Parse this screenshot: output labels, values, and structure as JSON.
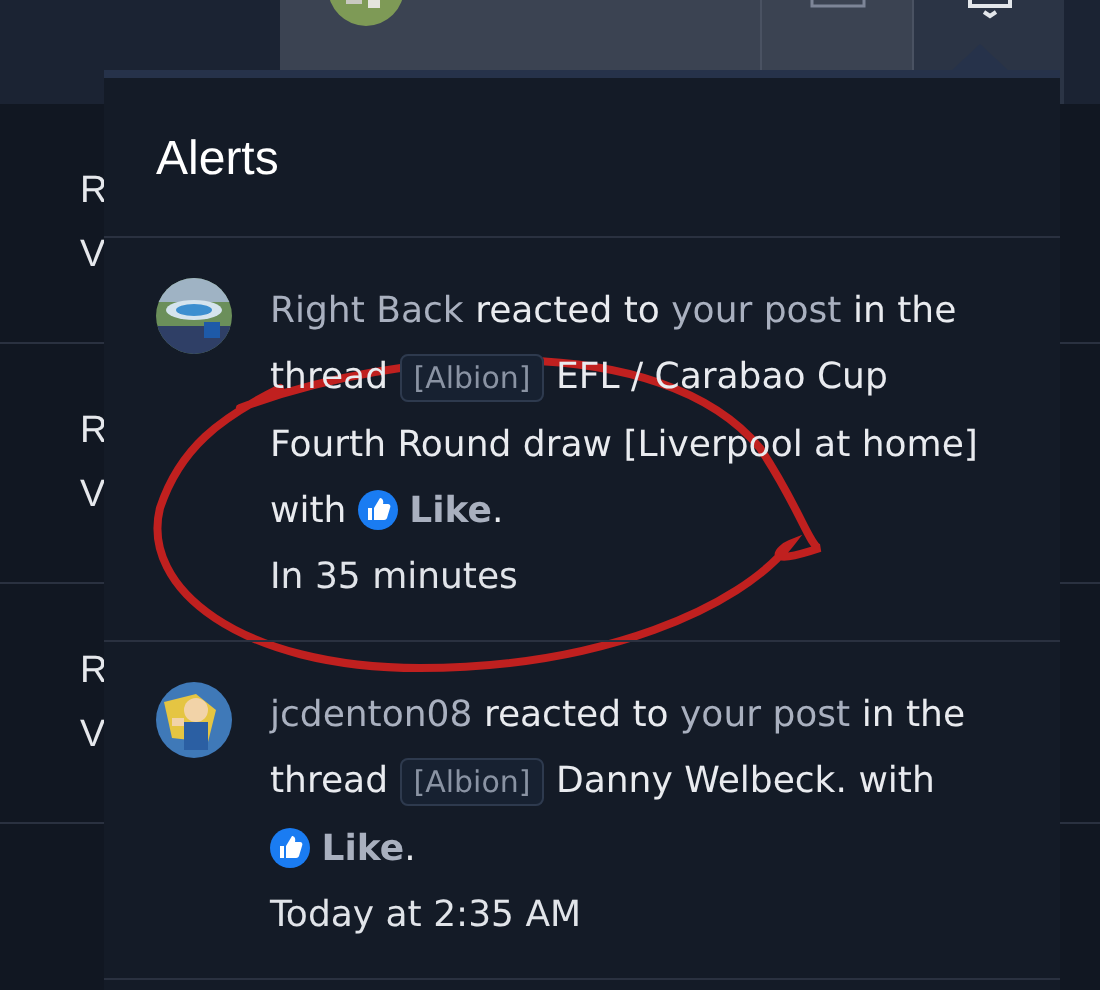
{
  "background_rows": [
    {
      "line_1": "R",
      "line_2": "V"
    },
    {
      "line_1": "R",
      "line_2": "V"
    },
    {
      "line_1": "R",
      "line_2": "V"
    }
  ],
  "alerts_popup": {
    "title": "Alerts",
    "alerts": [
      {
        "user": "Right Back",
        "text_1": "reacted to",
        "link": "your post",
        "text_2": "in the thread",
        "prefix": "[Albion]",
        "thread_title": "EFL / Carabao Cup Fourth Round draw [Liverpool at home]",
        "text_3": "with",
        "reaction": "Like",
        "text_4": ".",
        "time": "In 35 minutes"
      },
      {
        "user": "jcdenton08",
        "text_1": "reacted to",
        "link": "your post",
        "text_2": "in the thread",
        "prefix": "[Albion]",
        "thread_title": "Danny Welbeck.",
        "text_3": "with",
        "reaction": "Like",
        "text_4": ".",
        "time": "Today at 2:35 AM"
      }
    ]
  }
}
